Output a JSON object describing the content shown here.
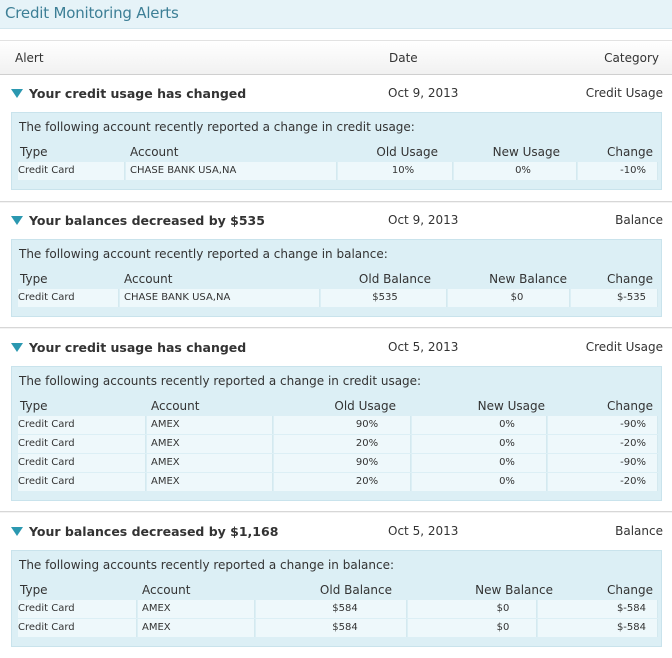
{
  "title": "Credit Monitoring Alerts",
  "columns": {
    "alert": "Alert",
    "date": "Date",
    "category": "Category"
  },
  "colors": {
    "accent": "#2b98b0",
    "title": "#3d7f96",
    "panel": "#dceff5",
    "row": "#eef8fb"
  },
  "alerts": [
    {
      "title": "Your credit usage has changed",
      "date": "Oct 9, 2013",
      "category": "Credit Usage",
      "description": "The following account recently reported a change in credit usage:",
      "headers": [
        "Type",
        "Account",
        "Old Usage",
        "New Usage",
        "Change"
      ],
      "rows": [
        [
          "Credit Card",
          "CHASE BANK USA,NA",
          "10%",
          "0%",
          "-10%"
        ]
      ]
    },
    {
      "title": "Your balances decreased by $535",
      "date": "Oct 9, 2013",
      "category": "Balance",
      "description": "The following account recently reported a change in balance:",
      "headers": [
        "Type",
        "Account",
        "Old Balance",
        "New Balance",
        "Change"
      ],
      "rows": [
        [
          "Credit Card",
          "CHASE BANK USA,NA",
          "$535",
          "$0",
          "$-535"
        ]
      ]
    },
    {
      "title": "Your credit usage has changed",
      "date": "Oct 5, 2013",
      "category": "Credit Usage",
      "description": "The following accounts recently reported a change in credit usage:",
      "headers": [
        "Type",
        "Account",
        "Old Usage",
        "New Usage",
        "Change"
      ],
      "rows": [
        [
          "Credit Card",
          "AMEX",
          "90%",
          "0%",
          "-90%"
        ],
        [
          "Credit Card",
          "AMEX",
          "20%",
          "0%",
          "-20%"
        ],
        [
          "Credit Card",
          "AMEX",
          "90%",
          "0%",
          "-90%"
        ],
        [
          "Credit Card",
          "AMEX",
          "20%",
          "0%",
          "-20%"
        ]
      ]
    },
    {
      "title": "Your balances decreased by $1,168",
      "date": "Oct 5, 2013",
      "category": "Balance",
      "description": "The following accounts recently reported a change in balance:",
      "headers": [
        "Type",
        "Account",
        "Old Balance",
        "New Balance",
        "Change"
      ],
      "rows": [
        [
          "Credit Card",
          "AMEX",
          "$584",
          "$0",
          "$-584"
        ],
        [
          "Credit Card",
          "AMEX",
          "$584",
          "$0",
          "$-584"
        ]
      ]
    }
  ]
}
